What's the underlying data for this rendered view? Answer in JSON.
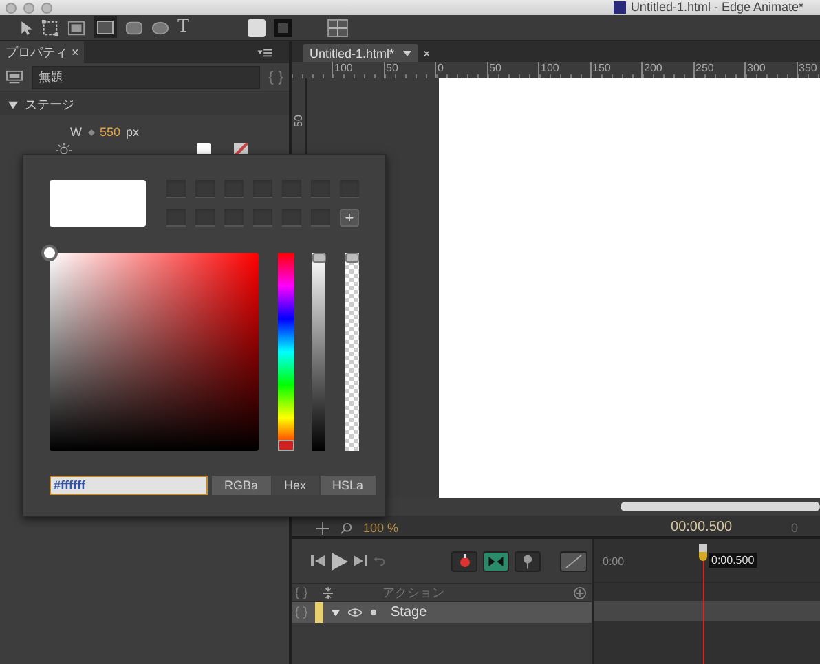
{
  "window": {
    "title": "Untitled-1.html - Edge Animate*"
  },
  "toolbar": {
    "text_tool": "T"
  },
  "properties_panel": {
    "tab": "プロパティ",
    "tab_close": "×",
    "element_name": "無題",
    "section": {
      "title": "ステージ",
      "expanded": true
    },
    "width": {
      "label": "W",
      "value": "550",
      "unit": "px"
    }
  },
  "document_tab": {
    "title": "Untitled-1.html*",
    "close": "×"
  },
  "ruler": {
    "left_labels": [
      "100",
      "50"
    ],
    "labels": [
      "0",
      "50",
      "100",
      "150",
      "200",
      "250",
      "300",
      "350"
    ],
    "vertical_label": "50"
  },
  "color_picker": {
    "hex_value": "#ffffff",
    "swatch_add": "+",
    "sliders": [
      {
        "kind": "hue",
        "level": 0
      },
      {
        "kind": "brightness",
        "level": 1
      },
      {
        "kind": "alpha",
        "level": 1
      }
    ],
    "modes": [
      {
        "label": "RGBa",
        "selected": false
      },
      {
        "label": "Hex",
        "selected": true
      },
      {
        "label": "HSLa",
        "selected": false
      }
    ]
  },
  "stage_bar": {
    "zoom": "100 %",
    "time": "00:00.500",
    "end_marker": "0"
  },
  "timeline": {
    "header": "アクション",
    "start_time": "0:00",
    "playhead_time": "0:00.500",
    "layers": [
      {
        "name": "Stage",
        "expanded": true
      }
    ]
  }
}
